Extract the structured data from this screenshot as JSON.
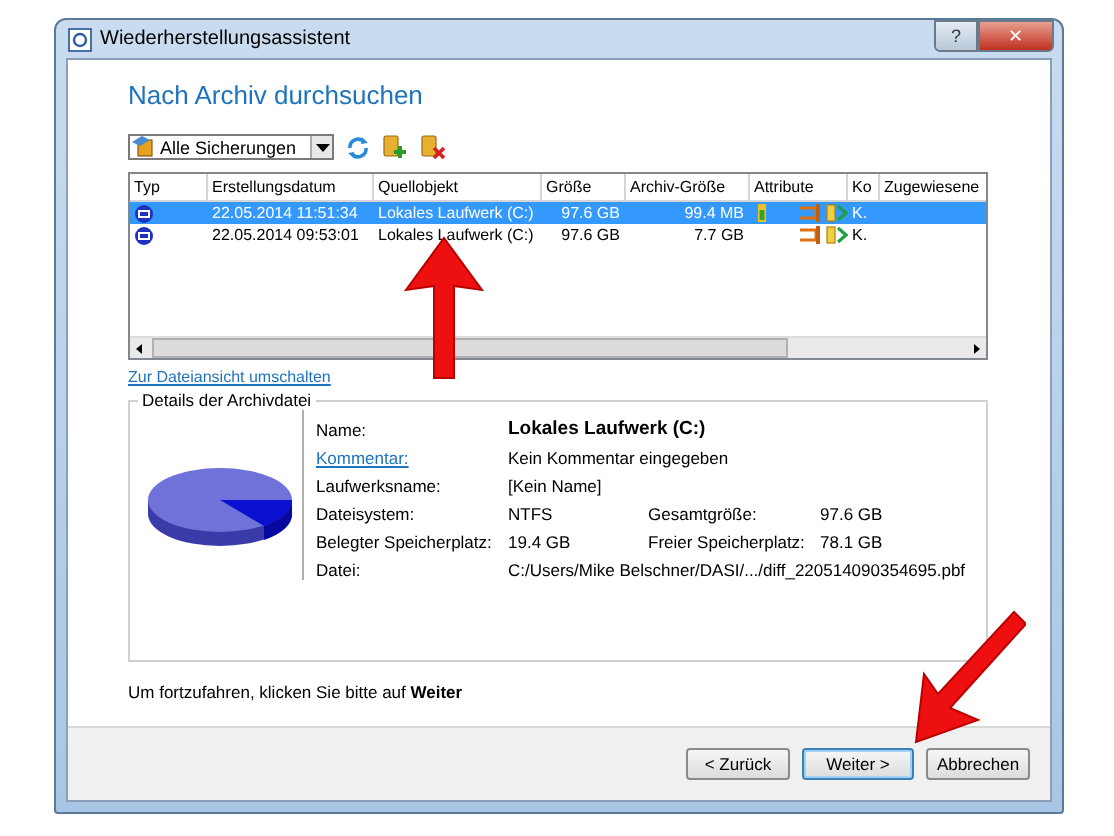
{
  "window": {
    "title": "Wiederherstellungsassistent",
    "title_buttons": [
      {
        "kind": "help",
        "label": "?"
      },
      {
        "kind": "close",
        "label": "✕"
      }
    ]
  },
  "heading": "Nach Archiv durchsuchen",
  "filter": {
    "value": "Alle Sicherungen"
  },
  "table": {
    "columns": [
      "Typ",
      "Erstellungsdatum",
      "Quellobjekt",
      "Größe",
      "Archiv-Größe",
      "Attribute",
      "Ko",
      "Zugewiesene"
    ],
    "rows": [
      {
        "selected": true,
        "date": "22.05.2014 11:51:34",
        "source": "Lokales Laufwerk (C:)",
        "size": "97.6 GB",
        "archive_size": "99.4 MB",
        "attributes": [
          {
            "kind": "level"
          },
          {
            "kind": "chain"
          },
          {
            "kind": "file"
          }
        ],
        "ko": "K."
      },
      {
        "selected": false,
        "date": "22.05.2014 09:53:01",
        "source": "Lokales Laufwerk (C:)",
        "size": "97.6 GB",
        "archive_size": "7.7 GB",
        "attributes": [
          {
            "kind": "chain"
          },
          {
            "kind": "file"
          }
        ],
        "ko": "K."
      }
    ]
  },
  "view_link": "Zur Dateiansicht umschalten",
  "details": {
    "title": "Details der Archivdatei",
    "name": {
      "label": "Name:",
      "value": "Lokales Laufwerk (C:)"
    },
    "comment": {
      "label": "Kommentar:",
      "value": "Kein Kommentar eingegeben"
    },
    "drive_name": {
      "label": "Laufwerksname:",
      "value": "[Kein Name]"
    },
    "filesystem": {
      "label": "Dateisystem:",
      "value": "NTFS"
    },
    "total": {
      "label": "Gesamtgröße:",
      "value": "97.6 GB"
    },
    "used": {
      "label": "Belegter Speicherplatz:",
      "value": "19.4 GB"
    },
    "free": {
      "label": "Freier Speicherplatz:",
      "value": "78.1 GB"
    },
    "file": {
      "label": "Datei:",
      "value": "C:/Users/Mike Belschner/DASI/.../diff_220514090354695.pbf"
    }
  },
  "hint": "Um fortzufahren, klicken Sie bitte auf **Weiter**",
  "buttons": [
    {
      "label": "< Zurück",
      "default": false
    },
    {
      "label": "Weiter >",
      "default": true
    },
    {
      "label": "Abbrechen",
      "default": false
    }
  ]
}
